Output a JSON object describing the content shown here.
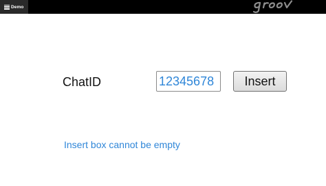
{
  "header": {
    "menu_label": "Demo",
    "menu_icon": "hamburger-menu-icon",
    "logo_text": "groov"
  },
  "form": {
    "chat_label": "ChatID",
    "chat_input_value": "12345678",
    "insert_button_label": "Insert",
    "error_message": "Insert box cannot be empty"
  },
  "colors": {
    "header_bg": "#000000",
    "accent_text": "#2f86d8"
  }
}
